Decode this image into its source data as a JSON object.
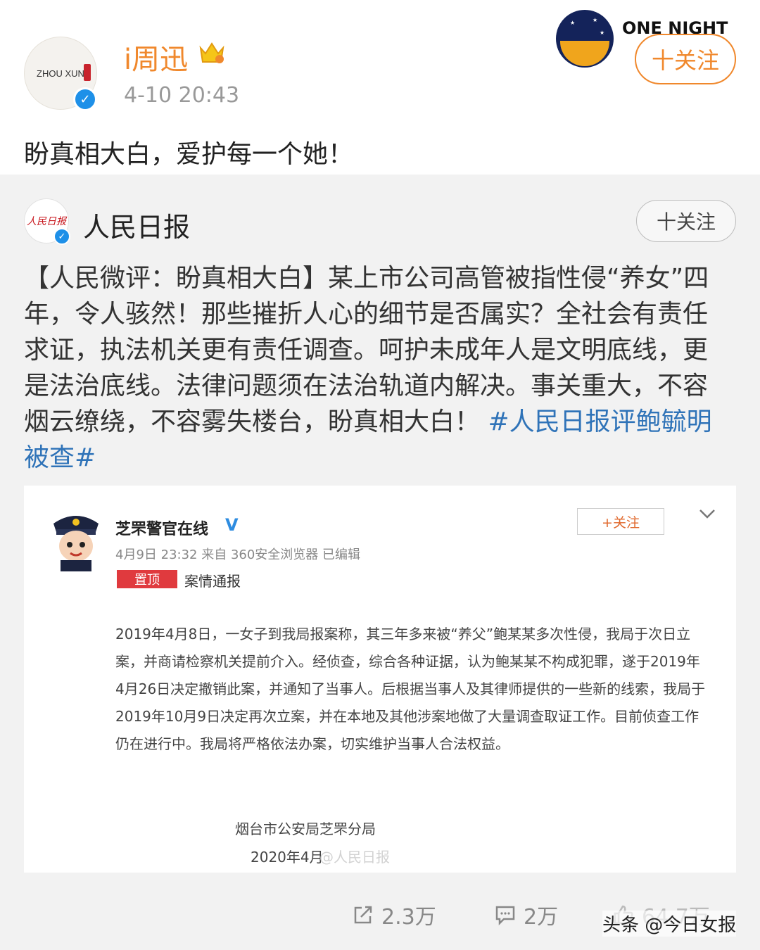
{
  "post": {
    "user_name": "i周迅",
    "avatar_text": "ZHOU XUN",
    "time": "4-10 20:43",
    "follow_label": "十关注",
    "text": "盼真相大白，爱护每一个她！",
    "brand_text": "ONE NIGHT"
  },
  "repost": {
    "user_name": "人民日报",
    "avatar_text": "人民日报",
    "follow_label": "十关注",
    "text": "【人民微评：盼真相大白】某上市公司高管被指性侵“养女”四年，令人骇然！那些摧折人心的细节是否属实？全社会有责任求证，执法机关更有责任调查。呵护未成年人是文明底线，更是法治底线。法律问题须在法治轨道内解决。事关重大，不容烟云缭绕，不容雾失楼台，盼真相大白！",
    "hashtag": "#人民日报评鲍毓明被查#",
    "embed": {
      "user_name": "芝罘警官在线",
      "verified_mark": "V",
      "meta": "4月9日 23:32 来自 360安全浏览器 已编辑",
      "follow_label": "+关注",
      "pin_label": "置顶",
      "category": "案情通报",
      "body": "2019年4月8日，一女子到我局报案称，其三年多来被“养父”鲍某某多次性侵，我局于次日立案，并商请检察机关提前介入。经侦查，综合各种证据，认为鲍某某不构成犯罪，遂于2019年4月26日决定撤销此案，并通知了当事人。后根据当事人及其律师提供的一些新的线索，我局于2019年10月9日决定再次立案，并在本地及其他涉案地做了大量调查取证工作。目前侦查工作仍在进行中。我局将严格依法办案，切实维护当事人合法权益。",
      "signature": "烟台市公安局芝罘分局",
      "date": "2020年4月",
      "watermark": "@人民日报"
    }
  },
  "actions": {
    "share_count": "2.3万",
    "comment_count": "2万",
    "like_count": "64.7万"
  },
  "footer": {
    "watermark": "头条 @今日女报"
  },
  "colors": {
    "accent_orange": "#f0882c",
    "verify_blue": "#1e90e8",
    "hashtag_blue": "#2f73b8",
    "pin_red": "#e03a3e"
  },
  "icons": [
    "crown-icon",
    "verified-icon",
    "share-icon",
    "comment-icon",
    "like-icon",
    "chevron-down-icon"
  ]
}
